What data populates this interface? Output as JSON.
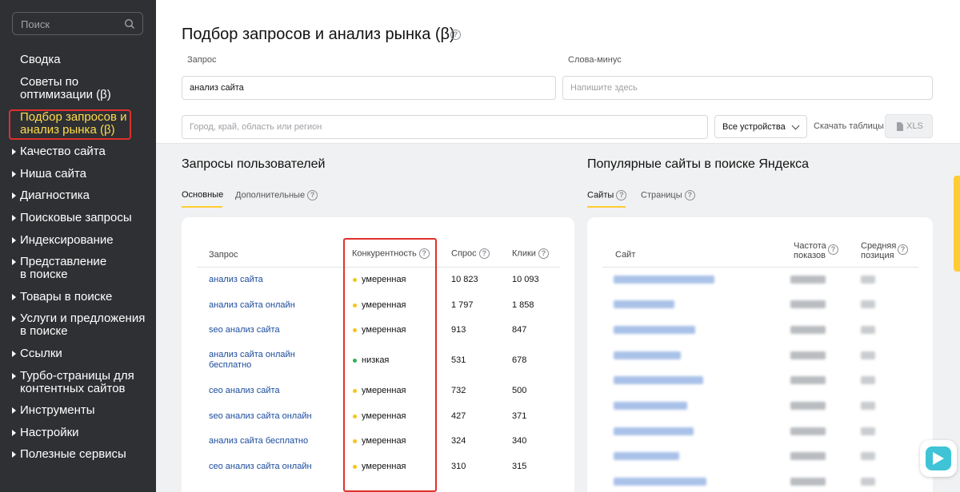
{
  "sidebar": {
    "search_placeholder": "Поиск",
    "items": [
      {
        "label": "Сводка"
      },
      {
        "label": "Советы по",
        "label2": "оптимизации (β)"
      },
      {
        "label": "Подбор запросов и",
        "label2": "анализ рынка (β)"
      },
      {
        "label": "Качество сайта"
      },
      {
        "label": "Ниша сайта"
      },
      {
        "label": "Диагностика"
      },
      {
        "label": "Поисковые запросы"
      },
      {
        "label": "Индексирование"
      },
      {
        "label": "Представление",
        "label2": "в поиске"
      },
      {
        "label": "Товары в поиске"
      },
      {
        "label": "Услуги и предложения",
        "label2": "в поиске"
      },
      {
        "label": "Ссылки"
      },
      {
        "label": "Турбо-страницы для",
        "label2": "контентных сайтов"
      },
      {
        "label": "Инструменты"
      },
      {
        "label": "Настройки"
      },
      {
        "label": "Полезные сервисы"
      }
    ]
  },
  "header": {
    "title": "Подбор запросов и анализ рынка (β)",
    "query_label": "Запрос",
    "query_value": "анализ сайта",
    "minus_label": "Слова-минус",
    "minus_placeholder": "Напишите здесь",
    "region_placeholder": "Город, край, область или регион",
    "devices_value": "Все устройства",
    "download_label": "Скачать таблицы",
    "xls_label": "XLS"
  },
  "queries": {
    "title": "Запросы пользователей",
    "tabs": [
      "Основные",
      "Дополнительные"
    ],
    "columns": [
      "Запрос",
      "Конкурентность",
      "Спрос",
      "Клики"
    ],
    "rows": [
      {
        "query": "анализ сайта",
        "query2": "",
        "competition": "умеренная",
        "level": "moderate",
        "demand": "10 823",
        "clicks": "10 093"
      },
      {
        "query": "анализ сайта онлайн",
        "query2": "",
        "competition": "умеренная",
        "level": "moderate",
        "demand": "1 797",
        "clicks": "1 858"
      },
      {
        "query": "seo анализ сайта",
        "query2": "",
        "competition": "умеренная",
        "level": "moderate",
        "demand": "913",
        "clicks": "847"
      },
      {
        "query": "анализ сайта онлайн",
        "query2": "бесплатно",
        "competition": "низкая",
        "level": "low",
        "demand": "531",
        "clicks": "678"
      },
      {
        "query": "сео анализ сайта",
        "query2": "",
        "competition": "умеренная",
        "level": "moderate",
        "demand": "732",
        "clicks": "500"
      },
      {
        "query": "seo анализ сайта онлайн",
        "query2": "",
        "competition": "умеренная",
        "level": "moderate",
        "demand": "427",
        "clicks": "371"
      },
      {
        "query": "анализ сайта бесплатно",
        "query2": "",
        "competition": "умеренная",
        "level": "moderate",
        "demand": "324",
        "clicks": "340"
      },
      {
        "query": "сео анализ сайта онлайн",
        "query2": "",
        "competition": "умеренная",
        "level": "moderate",
        "demand": "310",
        "clicks": "315"
      }
    ]
  },
  "popular": {
    "title": "Популярные сайты в поиске Яндекса",
    "tabs": [
      "Сайты",
      "Страницы"
    ],
    "col_site": "Сайт",
    "col_freq": "Частота",
    "col_freq2": "показов",
    "col_pos": "Средняя",
    "col_pos2": "позиция"
  },
  "colors": {
    "accent": "#ffcc33",
    "active_nav": "#ffdb4d",
    "highlight": "#e0302b",
    "link": "#1a4b9c",
    "moderate": "#f5c518",
    "low": "#2fb24a"
  }
}
